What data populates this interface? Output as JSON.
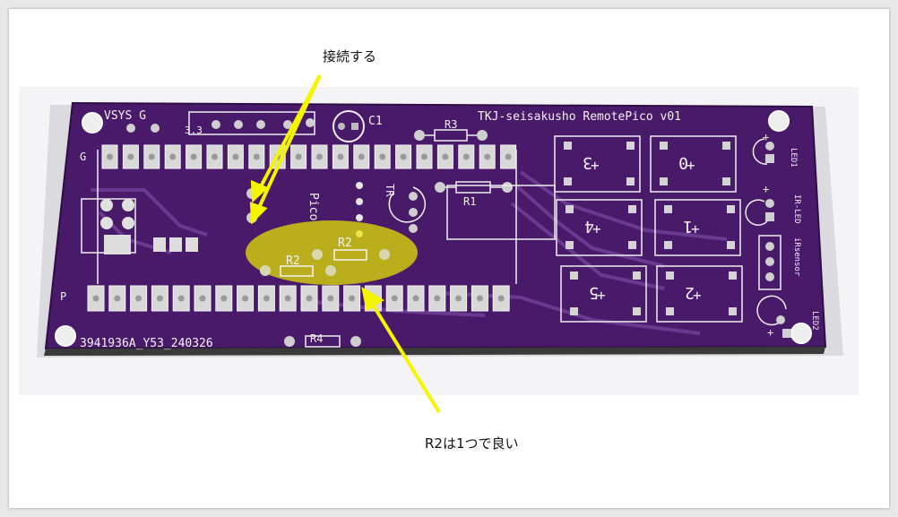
{
  "annotations": {
    "connect_label": "接続する",
    "r2_label": "R2は1つで良い"
  },
  "board": {
    "title": "TKJ-seisakusho  RemotePico v01",
    "serial": "3941936A_Y53_240326",
    "vsys": "VSYS G",
    "g_label": "G",
    "p_label": "P",
    "pin_33": "3.3",
    "c1": "C1",
    "r1": "R1",
    "r2": "R2",
    "r3": "R3",
    "r4": "R4",
    "tr": "TR",
    "pico": "Pico",
    "led1": "LED1",
    "led2": "LED2",
    "ir_led": "IR-LED",
    "ir_sensor": "iRsensor",
    "sw_labels": [
      "3",
      "0",
      "4",
      "1",
      "5",
      "2"
    ]
  },
  "colors": {
    "background": "#e8e8e8",
    "pcb": "#4a1a6a",
    "silkscreen": "#f2f2f2",
    "highlight": "#e8e800",
    "arrow": "#f5f500"
  }
}
